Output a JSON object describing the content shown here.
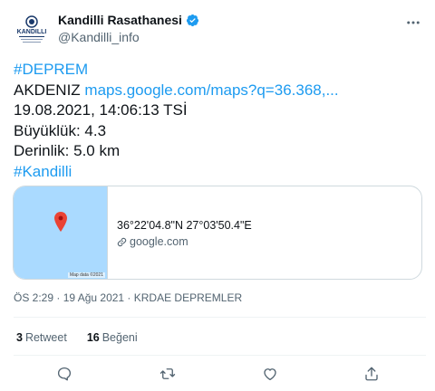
{
  "author": {
    "name": "Kandilli Rasathanesi",
    "handle": "@Kandilli_info",
    "logo_text": "KANDILLI",
    "verified_icon": "verified-badge-icon",
    "accent": "#1d9bf0"
  },
  "tweet": {
    "hashtag_top": "#DEPREM",
    "location": "AKDENIZ",
    "map_link": "maps.google.com/maps?q=36.368,...",
    "datetime_line": "19.08.2021, 14:06:13 TSİ",
    "magnitude_line": "Büyüklük: 4.3",
    "depth_line": "Derinlik: 5.0 km",
    "hashtag_bottom": "#Kandilli"
  },
  "card": {
    "coordinates": "36°22'04.8\"N 27°03'50.4\"E",
    "domain": "google.com",
    "map_credit": "Map data ©2021",
    "map_color": "#aadaff",
    "pin_color": "#ea4335"
  },
  "meta": {
    "text": "ÖS 2:29 · 19 Ağu 2021 · KRDAE DEPREMLER"
  },
  "stats": {
    "retweet_count": "3",
    "retweet_label": "Retweet",
    "like_count": "16",
    "like_label": "Beğeni"
  },
  "actions": [
    "reply-icon",
    "retweet-icon",
    "like-icon",
    "share-icon"
  ]
}
